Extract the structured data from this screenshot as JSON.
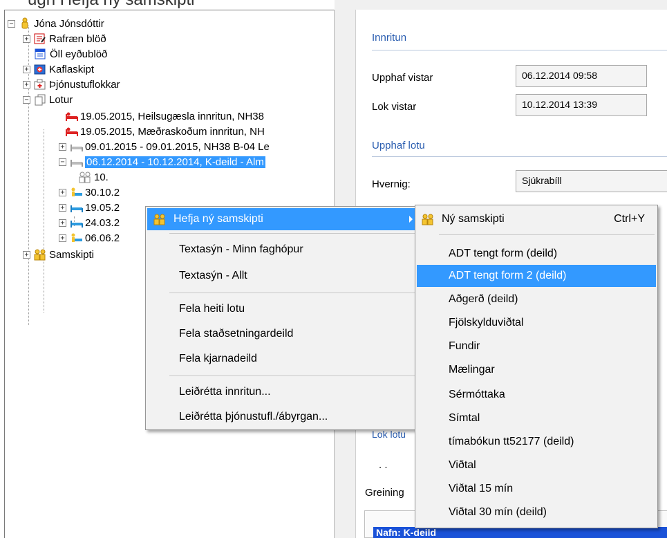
{
  "top_strip_text": "ugn Hefja ný samskipti",
  "tree": {
    "patient": "Jóna Jónsdóttir",
    "items": [
      {
        "label": "Rafræn blöð"
      },
      {
        "label": "Öll eyðublöð"
      },
      {
        "label": "Kaflaskipt"
      },
      {
        "label": "Þjónustuflokkar"
      },
      {
        "label": "Lotur"
      }
    ],
    "lotur": [
      {
        "label": "19.05.2015, Heilsugæsla innritun, NH38"
      },
      {
        "label": "19.05.2015, Mæðraskoðum innritun, NH"
      },
      {
        "label": "09.01.2015 - 09.01.2015, NH38 B-04 Le"
      },
      {
        "label": "06.12.2014 - 10.12.2014, K-deild - Alm"
      },
      {
        "label": "10."
      },
      {
        "label": "30.10.2"
      },
      {
        "label": "19.05.2"
      },
      {
        "label": "24.03.2"
      },
      {
        "label": "06.06.2"
      }
    ],
    "samskipti": "Samskipti"
  },
  "right": {
    "innritun_title": "Innritun",
    "upphaf_vistar_label": "Upphaf vistar",
    "upphaf_vistar_value": "06.12.2014 09:58",
    "lok_vistar_label": "Lok vistar",
    "lok_vistar_value": "10.12.2014 13:39",
    "upphaf_lotu_title": "Upphaf lotu",
    "hvernig_label": "Hvernig:",
    "hvernig_value": "Sjúkrabíll",
    "lok_lotu_title": "Lok lotu",
    "dots": ". .",
    "greining_label": "Greining",
    "bottom_text": "Nafn:   K-deild"
  },
  "context_menu": {
    "items": [
      {
        "label": "Hefja ný samskipti"
      },
      {
        "label": "Textasýn - Minn faghópur"
      },
      {
        "label": "Textasýn - Allt"
      },
      {
        "label": "Fela heiti lotu"
      },
      {
        "label": "Fela staðsetningardeild"
      },
      {
        "label": "Fela kjarnadeild"
      },
      {
        "label": "Leiðrétta innritun..."
      },
      {
        "label": "Leiðrétta þjónustufl./ábyrgan..."
      }
    ]
  },
  "submenu": {
    "first": {
      "label": "Ný samskipti",
      "shortcut": "Ctrl+Y"
    },
    "items": [
      {
        "label": "ADT tengt form (deild)"
      },
      {
        "label": "ADT tengt form 2 (deild)"
      },
      {
        "label": "Aðgerð (deild)"
      },
      {
        "label": "Fjölskylduviðtal"
      },
      {
        "label": "Fundir"
      },
      {
        "label": "Mælingar"
      },
      {
        "label": "Sérmóttaka"
      },
      {
        "label": "Símtal"
      },
      {
        "label": "tímabókun tt52177 (deild)"
      },
      {
        "label": "Viðtal"
      },
      {
        "label": "Viðtal 15 mín"
      },
      {
        "label": "Viðtal 30 mín (deild)"
      }
    ]
  },
  "colors": {
    "selection": "#3399ff",
    "section_title": "#2a5db0",
    "bottom_bar": "#1a52d8"
  }
}
